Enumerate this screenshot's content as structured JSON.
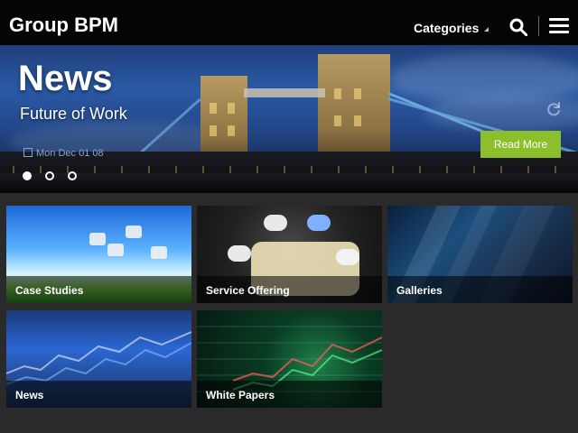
{
  "header": {
    "brand_left": "Group",
    "brand_right": "BPM",
    "categories_label": "Categories",
    "search_icon": "search-icon",
    "menu_icon": "hamburger-menu-icon"
  },
  "hero": {
    "title": "News",
    "subtitle": "Future of Work",
    "date_text": "Mon Dec 01 08",
    "read_more_label": "Read More",
    "carousel_total": 3,
    "carousel_active_index": 0,
    "refresh_icon": "refresh-icon"
  },
  "tiles": [
    {
      "label": "Case Studies"
    },
    {
      "label": "Service Offering"
    },
    {
      "label": "Galleries"
    },
    {
      "label": "News"
    },
    {
      "label": "White Papers"
    }
  ],
  "colors": {
    "header_bg": "#050505",
    "page_bg": "#2a2a2a",
    "accent": "#8bbf2b"
  }
}
